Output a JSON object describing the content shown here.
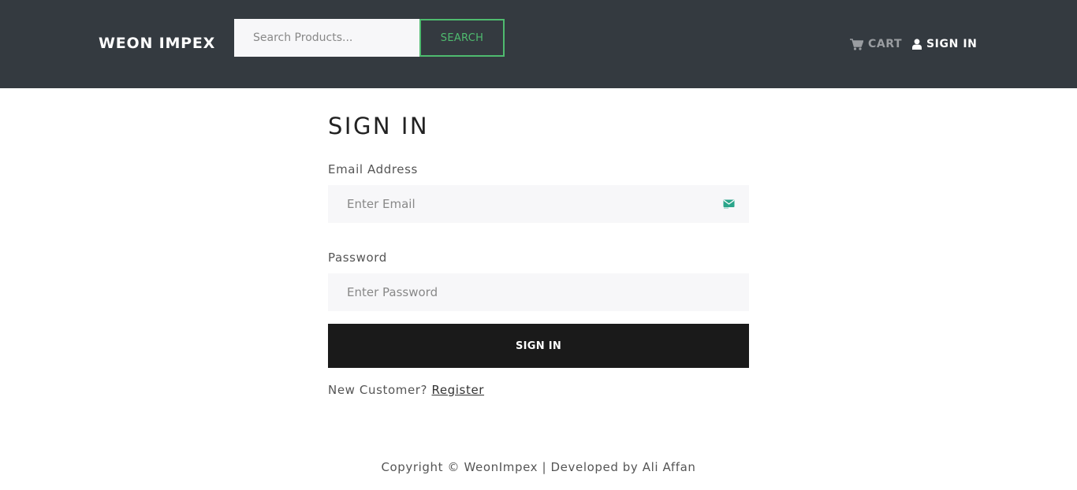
{
  "header": {
    "brand": "WEON IMPEX",
    "search": {
      "placeholder": "Search Products...",
      "value": "",
      "button_label": "SEARCH"
    },
    "nav": {
      "cart_label": "CART",
      "signin_label": "SIGN IN",
      "cart_icon": "cart-icon",
      "user_icon": "user-icon"
    }
  },
  "form": {
    "title": "SIGN IN",
    "email_label": "Email Address",
    "email_placeholder": "Enter Email",
    "email_value": "",
    "email_field_icon": "envelope-icon",
    "password_label": "Password",
    "password_placeholder": "Enter Password",
    "password_value": "",
    "submit_label": "SIGN IN",
    "new_customer_text": "New Customer?",
    "register_link": "Register"
  },
  "footer": {
    "text": "Copyright © WeonImpex | Developed by Ali Affan"
  },
  "colors": {
    "navbar_bg": "#343a40",
    "search_accent": "#4fbb6f",
    "submit_bg": "#1a1a1a",
    "input_bg": "#f7f7f9",
    "envelope_icon": "#2aa58a"
  }
}
